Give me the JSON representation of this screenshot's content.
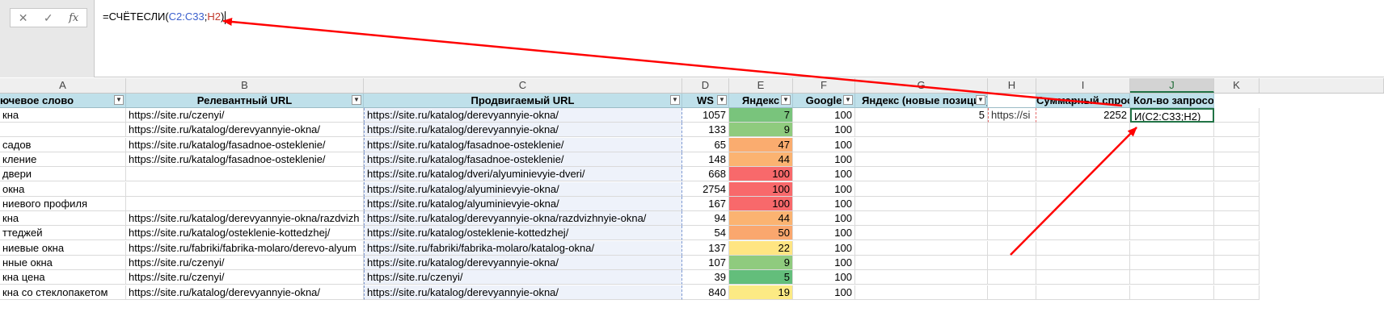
{
  "formula_bar": {
    "cancel_icon": "✕",
    "enter_icon": "✓",
    "fx_label": "fx",
    "formula_prefix": "=СЧЁТЕСЛИ(",
    "range1": "C2:C33",
    "separator": ";",
    "range2": "H2",
    "formula_suffix": ")"
  },
  "column_letters": [
    "A",
    "B",
    "C",
    "D",
    "E",
    "F",
    "G",
    "H",
    "I",
    "J",
    "K"
  ],
  "headers": {
    "A": "ючевое слово",
    "B": "Релевантный URL",
    "C": "Продвигаемый URL",
    "D": "WS",
    "E": "Яндекс",
    "F": "Google",
    "G": "Яндекс (новые позиции)",
    "H": "",
    "I": "Суммарный спрос",
    "J": "Кол-во запросов"
  },
  "rows": [
    {
      "a": "кна",
      "b": "https://site.ru/czenyi/",
      "c": "https://site.ru/katalog/derevyannyie-okna/",
      "d": "1057",
      "e": "7",
      "f": "100",
      "g": "5",
      "h": "https://si",
      "i": "2252",
      "j": "И(C2:C33;H2)"
    },
    {
      "a": "",
      "b": "https://site.ru/katalog/derevyannyie-okna/",
      "c": "https://site.ru/katalog/derevyannyie-okna/",
      "d": "133",
      "e": "9",
      "f": "100"
    },
    {
      "a": "садов",
      "b": "https://site.ru/katalog/fasadnoe-osteklenie/",
      "c": "https://site.ru/katalog/fasadnoe-osteklenie/",
      "d": "65",
      "e": "47",
      "f": "100"
    },
    {
      "a": "кление",
      "b": "https://site.ru/katalog/fasadnoe-osteklenie/",
      "c": "https://site.ru/katalog/fasadnoe-osteklenie/",
      "d": "148",
      "e": "44",
      "f": "100"
    },
    {
      "a": "двери",
      "b": "",
      "c": "https://site.ru/katalog/dveri/alyuminievyie-dveri/",
      "d": "668",
      "e": "100",
      "f": "100"
    },
    {
      "a": "окна",
      "b": "",
      "c": "https://site.ru/katalog/alyuminievyie-okna/",
      "d": "2754",
      "e": "100",
      "f": "100"
    },
    {
      "a": "ниевого профиля",
      "b": "",
      "c": "https://site.ru/katalog/alyuminievyie-okna/",
      "d": "167",
      "e": "100",
      "f": "100"
    },
    {
      "a": "кна",
      "b": "https://site.ru/katalog/derevyannyie-okna/razdvizh",
      "c": "https://site.ru/katalog/derevyannyie-okna/razdvizhnyie-okna/",
      "d": "94",
      "e": "44",
      "f": "100"
    },
    {
      "a": "ттеджей",
      "b": "https://site.ru/katalog/osteklenie-kottedzhej/",
      "c": "https://site.ru/katalog/osteklenie-kottedzhej/",
      "d": "54",
      "e": "50",
      "f": "100"
    },
    {
      "a": "ниевые окна",
      "b": "https://site.ru/fabriki/fabrika-molaro/derevo-alyum",
      "c": "https://site.ru/fabriki/fabrika-molaro/katalog-okna/",
      "d": "137",
      "e": "22",
      "f": "100"
    },
    {
      "a": "нные окна",
      "b": "https://site.ru/czenyi/",
      "c": "https://site.ru/katalog/derevyannyie-okna/",
      "d": "107",
      "e": "9",
      "f": "100"
    },
    {
      "a": "кна цена",
      "b": "https://site.ru/czenyi/",
      "c": "https://site.ru/czenyi/",
      "d": "39",
      "e": "5",
      "f": "100"
    },
    {
      "a": "кна со стеклопакетом",
      "b": "https://site.ru/katalog/derevyannyie-okna/",
      "c": "https://site.ru/katalog/derevyannyie-okna/",
      "d": "840",
      "e": "19",
      "f": "100"
    }
  ],
  "colors": {
    "header_bg": "#bfe0ea",
    "arrow": "#ff0000",
    "range1_color": "#3a5fcd",
    "range2_color": "#c0392b",
    "selected_border": "#217346"
  }
}
